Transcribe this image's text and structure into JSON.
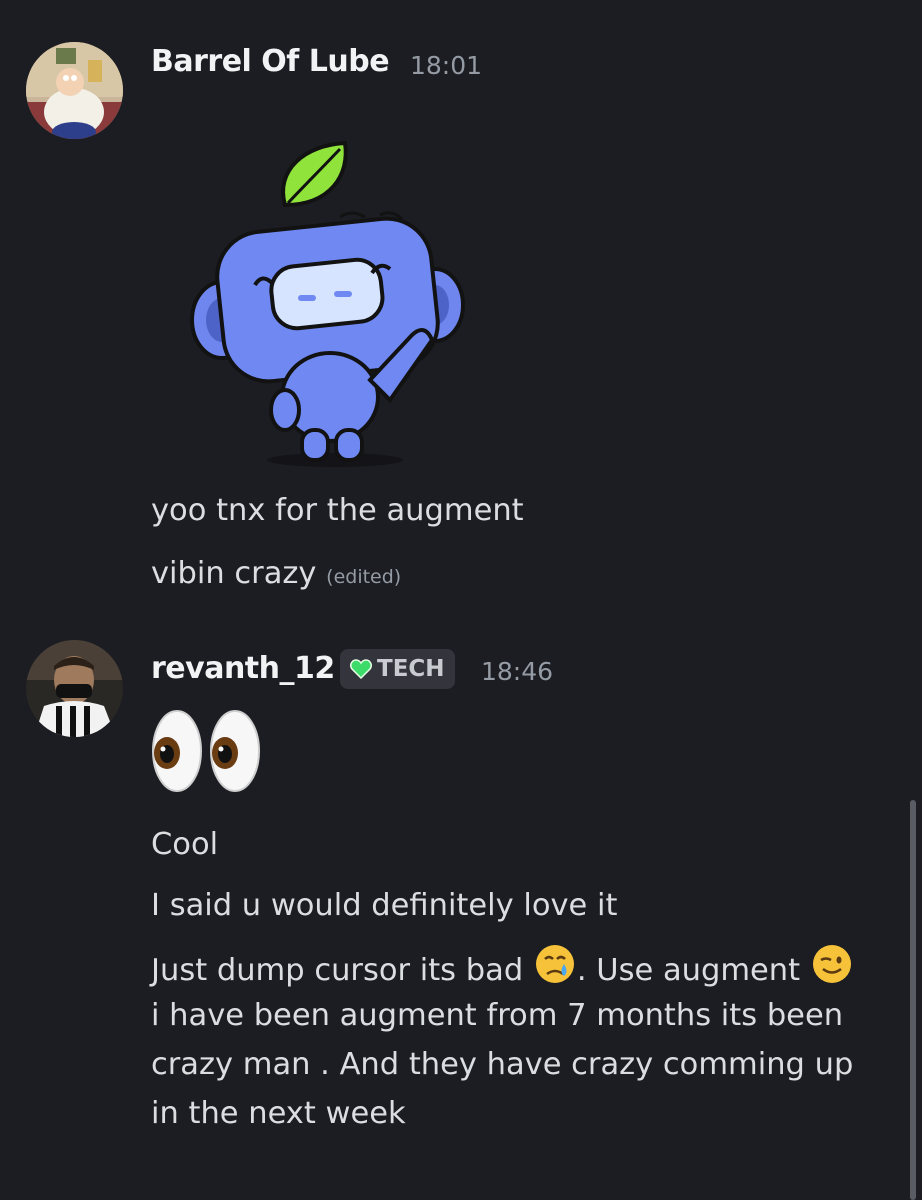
{
  "messages": [
    {
      "author": "Barrel Of Lube",
      "time": "18:01",
      "sticker": "wumpus-wave-sticker",
      "lines": [
        "yoo tnx for the augment",
        "vibin crazy"
      ],
      "edited_label": "(edited)"
    },
    {
      "author": "revanth_12",
      "tag": "TECH",
      "time": "18:46",
      "big_emoji": "eyes-emoji",
      "lines": [
        "Cool",
        "I said u would definitely love it",
        "Just dump cursor its bad",
        ". Use augment",
        "i have been augment from 7 months its been",
        "crazy man . And they have crazy comming up",
        "in the next week"
      ]
    }
  ],
  "colors": {
    "background": "#1c1d22",
    "author": "#f2f3f5",
    "text": "#dbdee1",
    "muted": "#949ba4",
    "tag_bg": "#34353c"
  }
}
